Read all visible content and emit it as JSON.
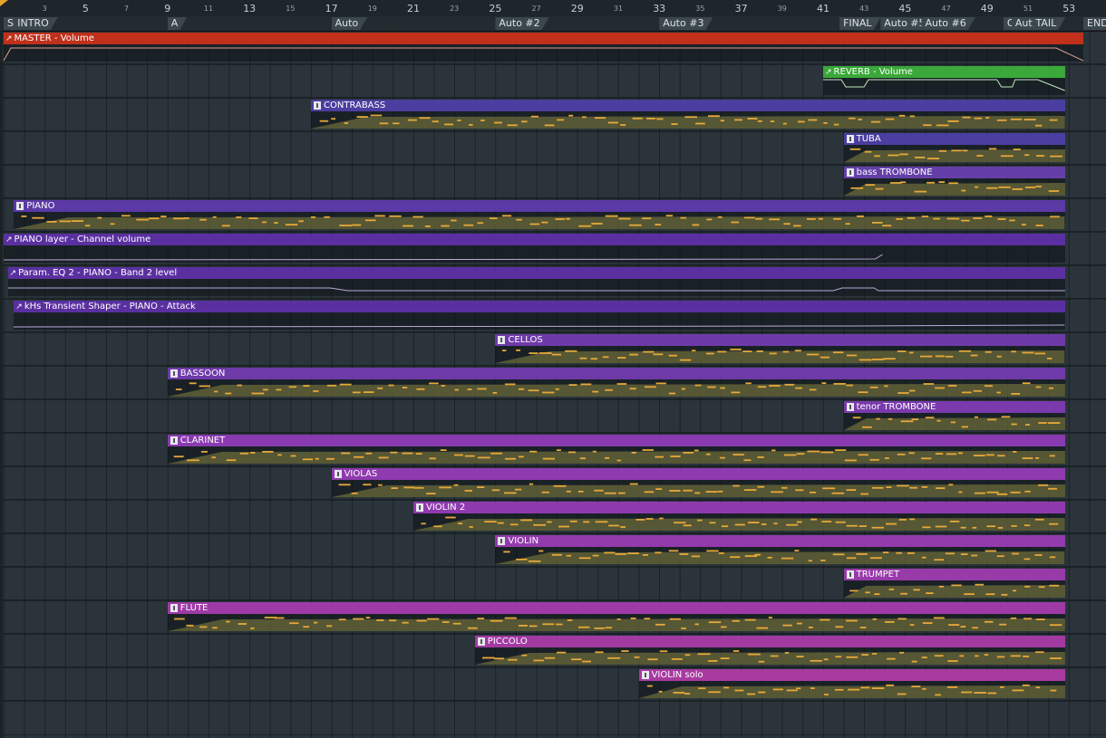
{
  "ruler": {
    "major": [
      {
        "label": "3",
        "bar": 3
      },
      {
        "label": "5",
        "bar": 5
      },
      {
        "label": "7",
        "bar": 7
      },
      {
        "label": "9",
        "bar": 9
      },
      {
        "label": "11",
        "bar": 11
      },
      {
        "label": "13",
        "bar": 13
      },
      {
        "label": "15",
        "bar": 15
      },
      {
        "label": "17",
        "bar": 17
      },
      {
        "label": "19",
        "bar": 19
      },
      {
        "label": "21",
        "bar": 21
      },
      {
        "label": "23",
        "bar": 23
      },
      {
        "label": "25",
        "bar": 25
      },
      {
        "label": "27",
        "bar": 27
      },
      {
        "label": "29",
        "bar": 29
      },
      {
        "label": "31",
        "bar": 31
      },
      {
        "label": "33",
        "bar": 33
      },
      {
        "label": "35",
        "bar": 35
      },
      {
        "label": "37",
        "bar": 37
      },
      {
        "label": "39",
        "bar": 39
      },
      {
        "label": "41",
        "bar": 41
      },
      {
        "label": "43",
        "bar": 43
      },
      {
        "label": "45",
        "bar": 45
      },
      {
        "label": "47",
        "bar": 47
      },
      {
        "label": "49",
        "bar": 49
      },
      {
        "label": "51",
        "bar": 51
      },
      {
        "label": "53",
        "bar": 53
      }
    ]
  },
  "markers": [
    {
      "label": "S",
      "bar": 1
    },
    {
      "label": "INTRO",
      "bar": 1.5
    },
    {
      "label": "A",
      "bar": 9
    },
    {
      "label": "Auto",
      "bar": 17
    },
    {
      "label": "Auto #2",
      "bar": 25
    },
    {
      "label": "Auto #3",
      "bar": 33
    },
    {
      "label": "FINAL",
      "bar": 41.8
    },
    {
      "label": "Auto #5",
      "bar": 43.8
    },
    {
      "label": "Auto #6",
      "bar": 45.8
    },
    {
      "label": "O",
      "bar": 49.8
    },
    {
      "label": "Auto",
      "bar": 50.2
    },
    {
      "label": "TAIL",
      "bar": 51.2
    },
    {
      "label": "END",
      "bar": 53.7
    }
  ],
  "colors": {
    "master": "#c0301a",
    "reverb": "#3aa83a",
    "contrabass": "#4a3ea0",
    "tuba": "#4a3ea0",
    "bass_trombone": "#6a3ea8",
    "piano": "#5a3aa6",
    "purple_dark": "#4e2f8e",
    "cellos": "#6e3aa8",
    "bassoon": "#6e3aa8",
    "violet": "#8a3ab0",
    "magenta": "#9a3aa8",
    "pink": "#a23a9e",
    "notes": "#e6a83a",
    "body_fill": "#6b6a3a"
  },
  "tracks": [
    {
      "id": "master",
      "name": "MASTER - Volume",
      "type": "auto",
      "start": 1,
      "end": 53.7,
      "color": "#c0301a"
    },
    {
      "id": "reverb",
      "name": "REVERB - Volume",
      "type": "auto",
      "start": 41,
      "end": 52.8,
      "color": "#3aa83a"
    },
    {
      "id": "contrabass",
      "name": "CONTRABASS",
      "type": "pattern",
      "start": 16,
      "end": 52.8,
      "color": "#4a3ea0"
    },
    {
      "id": "tuba",
      "name": "TUBA",
      "type": "pattern",
      "start": 42,
      "end": 52.8,
      "color": "#4a3ea0"
    },
    {
      "id": "bass-trombone",
      "name": "bass TROMBONE",
      "type": "pattern",
      "start": 42,
      "end": 52.8,
      "color": "#643fa8"
    },
    {
      "id": "piano",
      "name": "PIANO",
      "type": "pattern",
      "start": 1.5,
      "end": 52.8,
      "color": "#5b39a6"
    },
    {
      "id": "piano-layer",
      "name": "PIANO layer - Channel volume",
      "type": "auto",
      "start": 1,
      "end": 52.8,
      "color": "#5a30a0"
    },
    {
      "id": "param-eq",
      "name": "Param. EQ 2 - PIANO - Band 2 level",
      "type": "auto",
      "start": 1.2,
      "end": 52.8,
      "color": "#5a30a0"
    },
    {
      "id": "transient",
      "name": "kHs Transient Shaper - PIANO - Attack",
      "type": "auto",
      "start": 1.5,
      "end": 52.8,
      "color": "#5a30a0"
    },
    {
      "id": "cellos",
      "name": "CELLOS",
      "type": "pattern",
      "start": 25,
      "end": 52.8,
      "color": "#6e3aa8"
    },
    {
      "id": "bassoon",
      "name": "BASSOON",
      "type": "pattern",
      "start": 9,
      "end": 52.8,
      "color": "#6e3aa8"
    },
    {
      "id": "tenor-trombone",
      "name": "tenor TROMBONE",
      "type": "pattern",
      "start": 42,
      "end": 52.8,
      "color": "#7a3aac"
    },
    {
      "id": "clarinet",
      "name": "CLARINET",
      "type": "pattern",
      "start": 9,
      "end": 52.8,
      "color": "#8a3ab0"
    },
    {
      "id": "violas",
      "name": "VIOLAS",
      "type": "pattern",
      "start": 17,
      "end": 52.8,
      "color": "#8f3aae"
    },
    {
      "id": "violin2",
      "name": "VIOLIN 2",
      "type": "pattern",
      "start": 21,
      "end": 52.8,
      "color": "#8f3aae"
    },
    {
      "id": "violin",
      "name": "VIOLIN",
      "type": "pattern",
      "start": 25,
      "end": 52.8,
      "color": "#933aac"
    },
    {
      "id": "trumpet",
      "name": "TRUMPET",
      "type": "pattern",
      "start": 42,
      "end": 52.8,
      "color": "#983aa8"
    },
    {
      "id": "flute",
      "name": "FLUTE",
      "type": "pattern",
      "start": 9,
      "end": 52.8,
      "color": "#9e3aa6"
    },
    {
      "id": "piccolo",
      "name": "PICCOLO",
      "type": "pattern",
      "start": 24,
      "end": 52.8,
      "color": "#a23aa2"
    },
    {
      "id": "violin-solo",
      "name": "VIOLIN solo",
      "type": "pattern",
      "start": 32,
      "end": 52.8,
      "color": "#a83aa0"
    }
  ]
}
